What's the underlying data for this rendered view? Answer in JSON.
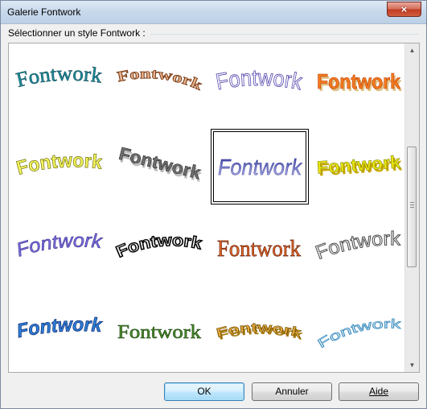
{
  "window": {
    "title": "Galerie Fontwork",
    "close_label": "×"
  },
  "group": {
    "label": "Sélectionner un style Fontwork :"
  },
  "gallery": {
    "selected_index": 6,
    "items": [
      {
        "text": "Fontwork",
        "style": "arch-teal"
      },
      {
        "text": "Fontwork",
        "style": "arc-brown"
      },
      {
        "text": "Fontwork",
        "style": "outline-purple"
      },
      {
        "text": "Fontwork",
        "style": "orange-3d"
      },
      {
        "text": "Fontwork",
        "style": "yellow-slant"
      },
      {
        "text": "Fontwork",
        "style": "gray-3d"
      },
      {
        "text": "Fontwork",
        "style": "blue-gradient"
      },
      {
        "text": "Fontwork",
        "style": "yellow-3d"
      },
      {
        "text": "Fontwork",
        "style": "wave-purple"
      },
      {
        "text": "Fontwork",
        "style": "arch-black"
      },
      {
        "text": "Fontwork",
        "style": "orange-outline"
      },
      {
        "text": "Fontwork",
        "style": "arc-gray"
      },
      {
        "text": "Fontwork",
        "style": "blue-3d"
      },
      {
        "text": "Fontwork",
        "style": "green"
      },
      {
        "text": "Fontwork",
        "style": "arc-gold"
      },
      {
        "text": "Fontwork",
        "style": "arc-light-blue"
      }
    ]
  },
  "buttons": {
    "ok": "OK",
    "cancel": "Annuler",
    "help": "Aide"
  },
  "colors": {
    "titlebar": "#c9d9ec",
    "close": "#c23b22",
    "default_button": "#bee6fd"
  }
}
